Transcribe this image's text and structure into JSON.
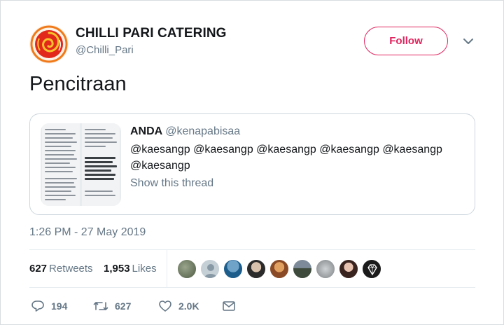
{
  "author": {
    "name": "CHILLI PARI CATERING",
    "handle": "@Chilli_Pari",
    "avatar_icon": "chilli-pari-logo",
    "logo_colors": [
      "#e2281b",
      "#f07a1a",
      "#f6c12a"
    ]
  },
  "follow_button": {
    "label": "Follow",
    "color": "#e0245e"
  },
  "menu_icon": "chevron-down-icon",
  "tweet": {
    "text": "Pencitraan"
  },
  "quoted": {
    "name": "ANDA",
    "handle": "@kenapabisaa",
    "text": "@kaesangp @kaesangp @kaesangp @kaesangp @kaesangp @kaesangp",
    "show_thread": "Show this thread"
  },
  "timestamp": "1:26 PM - 27 May 2019",
  "stats": {
    "retweets_count": "627",
    "retweets_label": "Retweets",
    "likes_count": "1,953",
    "likes_label": "Likes"
  },
  "likers_count": 10,
  "actions": {
    "replies": "194",
    "retweets": "627",
    "likes": "2.0K"
  }
}
